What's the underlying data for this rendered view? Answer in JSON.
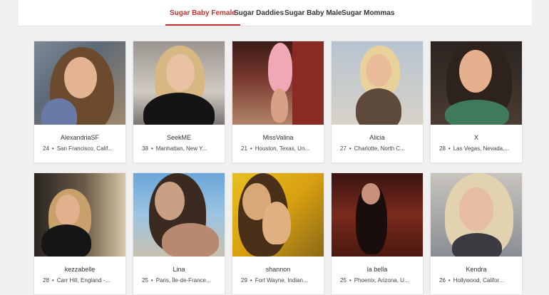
{
  "tabs": [
    {
      "label": "Sugar Baby Female",
      "active": true
    },
    {
      "label": "Sugar Daddies",
      "active": false
    },
    {
      "label": "Sugar Baby Male",
      "active": false
    },
    {
      "label": "Sugar Mommas",
      "active": false
    }
  ],
  "colors": {
    "accent": "#c0312d"
  },
  "profiles": [
    {
      "name": "AlexandriaSF",
      "age": "24",
      "location": "San Francisco, Calif..."
    },
    {
      "name": "SeekME",
      "age": "38",
      "location": "Manhattan, New Y..."
    },
    {
      "name": "MissValina",
      "age": "21",
      "location": "Houston, Texas, Un..."
    },
    {
      "name": "Alicia",
      "age": "27",
      "location": "Charlotte, North C..."
    },
    {
      "name": "X",
      "age": "28",
      "location": "Las Vegas, Nevada,..."
    },
    {
      "name": "kezzabelle",
      "age": "28",
      "location": "Carr Hill, England -..."
    },
    {
      "name": "Lina",
      "age": "25",
      "location": "Paris, Île-de-France..."
    },
    {
      "name": "shannon",
      "age": "29",
      "location": "Fort Wayne, Indian..."
    },
    {
      "name": "la bella",
      "age": "25",
      "location": "Phoenix, Arizona, U..."
    },
    {
      "name": "Kendra",
      "age": "26",
      "location": "Hollywood, Califor..."
    }
  ]
}
